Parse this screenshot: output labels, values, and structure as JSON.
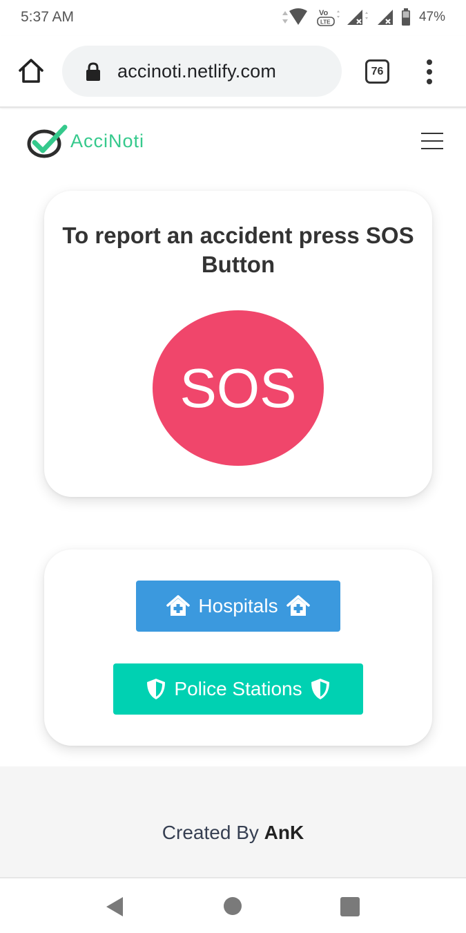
{
  "status_bar": {
    "time": "5:37 AM",
    "volte_label": "Vo LTE",
    "battery_percent": "47%"
  },
  "browser": {
    "url": "accinoti.netlify.com",
    "tab_count": "76"
  },
  "site": {
    "logo_text": "AcciNoti",
    "brand_color": "#35c98c"
  },
  "sos_card": {
    "title": "To report an accident press SOS Button",
    "sos_label": "SOS",
    "sos_color": "#f0466b"
  },
  "links_card": {
    "hospitals_label": "Hospitals",
    "hospitals_color": "#3b99de",
    "police_label": "Police Stations",
    "police_color": "#00d1b2"
  },
  "footer": {
    "created_by_label": "Created By",
    "author": "AnK"
  },
  "icons": {
    "home": "home-icon",
    "lock": "lock-icon",
    "menu": "more-vert-icon",
    "hamburger": "hamburger-icon",
    "hospital": "hospital-house-icon",
    "police": "shield-icon",
    "nav_back": "back-triangle-icon",
    "nav_home": "home-circle-icon",
    "nav_recent": "recent-apps-square-icon"
  }
}
